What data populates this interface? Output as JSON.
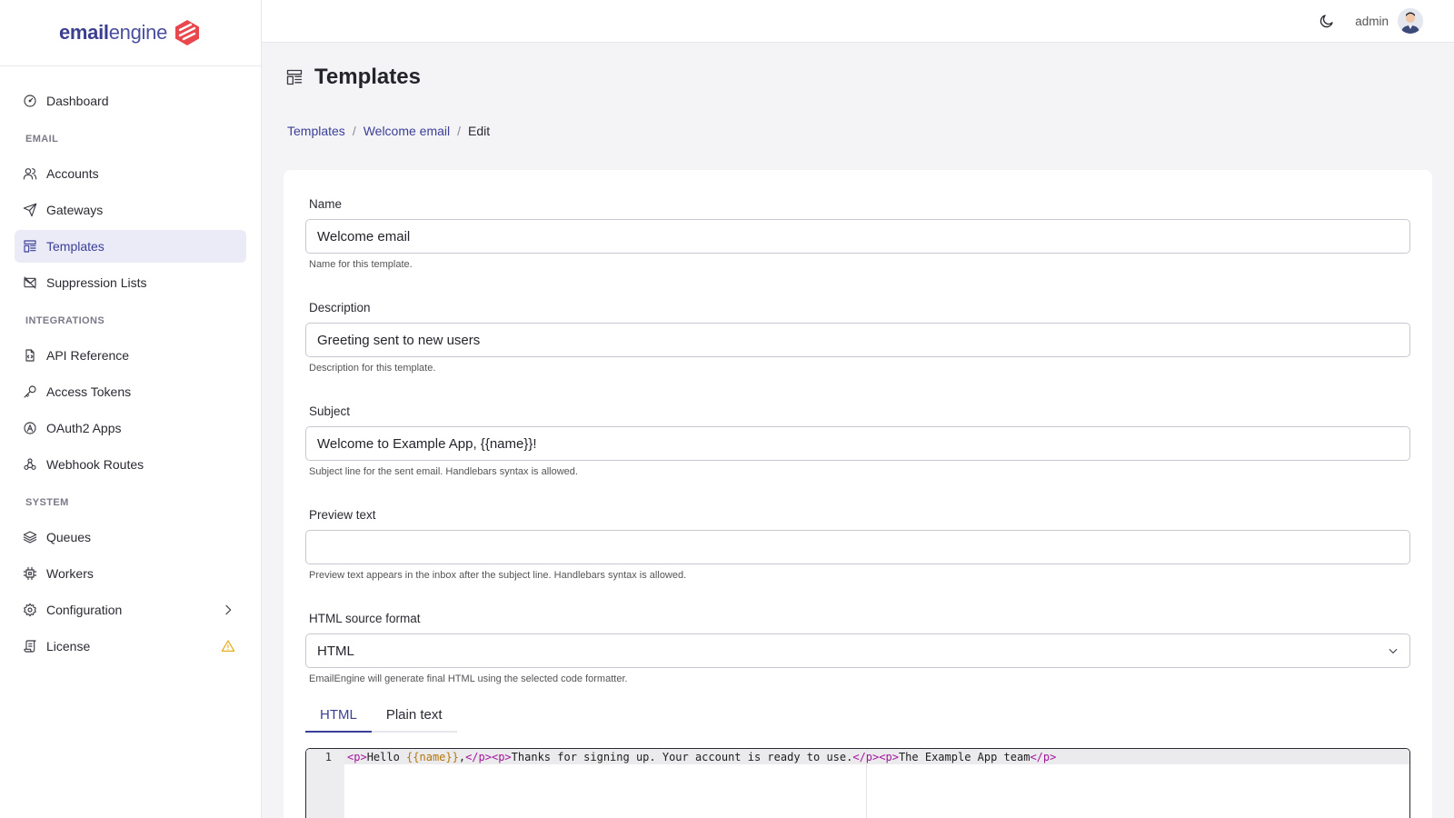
{
  "app": {
    "logo_bold": "email",
    "logo_light": "engine"
  },
  "header": {
    "username": "admin"
  },
  "sidebar": {
    "items": [
      {
        "label": "Dashboard"
      },
      {
        "section": "EMAIL"
      },
      {
        "label": "Accounts"
      },
      {
        "label": "Gateways"
      },
      {
        "label": "Templates",
        "active": true
      },
      {
        "label": "Suppression Lists"
      },
      {
        "section": "INTEGRATIONS"
      },
      {
        "label": "API Reference"
      },
      {
        "label": "Access Tokens"
      },
      {
        "label": "OAuth2 Apps"
      },
      {
        "label": "Webhook Routes"
      },
      {
        "section": "SYSTEM"
      },
      {
        "label": "Queues"
      },
      {
        "label": "Workers"
      },
      {
        "label": "Configuration"
      },
      {
        "label": "License"
      }
    ]
  },
  "page": {
    "title": "Templates",
    "breadcrumb": [
      "Templates",
      "Welcome email",
      "Edit"
    ]
  },
  "form": {
    "name": {
      "label": "Name",
      "value": "Welcome email",
      "help": "Name for this template."
    },
    "description": {
      "label": "Description",
      "value": "Greeting sent to new users",
      "help": "Description for this template."
    },
    "subject": {
      "label": "Subject",
      "value": "Welcome to Example App, {{name}}!",
      "help": "Subject line for the sent email. Handlebars syntax is allowed."
    },
    "preview": {
      "label": "Preview text",
      "value": "",
      "help": "Preview text appears in the inbox after the subject line. Handlebars syntax is allowed."
    },
    "format": {
      "label": "HTML source format",
      "value": "HTML",
      "help": "EmailEngine will generate final HTML using the selected code formatter."
    }
  },
  "tabs": [
    "HTML",
    "Plain text"
  ],
  "editor": {
    "line_number": "1",
    "code_parts": [
      "<p>",
      "Hello ",
      "{{name}}",
      ",",
      "</p>",
      "<p>",
      "Thanks for signing up. Your account is ready to use.",
      "</p>",
      "<p>",
      "The Example App team",
      "</p>"
    ]
  },
  "colors": {
    "accent": "#3b3f97",
    "logo_mark": "#e8474e",
    "warning": "#e5a50a"
  }
}
